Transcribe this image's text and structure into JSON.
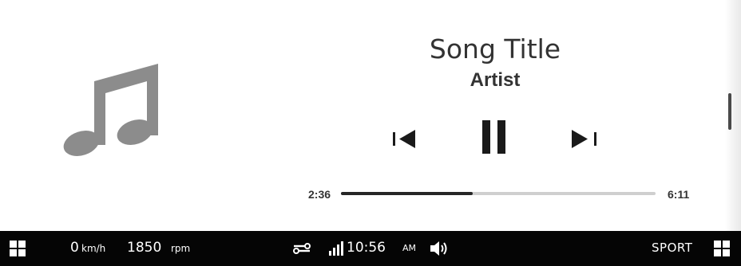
{
  "now_playing": {
    "song_title": "Song Title",
    "artist": "Artist",
    "album_art_icon": "music-note-icon"
  },
  "controls": {
    "previous_icon": "skip-previous-icon",
    "play_pause_icon": "pause-icon",
    "next_icon": "skip-next-icon"
  },
  "progress": {
    "elapsed": "2:36",
    "total": "6:11",
    "fraction": 0.42
  },
  "status_bar": {
    "speed_value": "0",
    "speed_unit": "km/h",
    "rpm_value": "1850",
    "rpm_unit": "rpm",
    "clock": "10:56",
    "ampm": "AM",
    "drive_mode": "SPORT",
    "left_icon": "apps-grid-icon",
    "right_icon": "apps-grid-icon",
    "connection_icon": "connection-icon",
    "signal_icon": "signal-bars-icon",
    "volume_icon": "volume-icon"
  },
  "colors": {
    "background": "#ffffff",
    "text": "#333333",
    "album_art": "#8c8c8c",
    "progress_fill": "#262626",
    "progress_track": "#cfcfcf",
    "status_bar": "#050505",
    "status_text": "#ffffff"
  }
}
